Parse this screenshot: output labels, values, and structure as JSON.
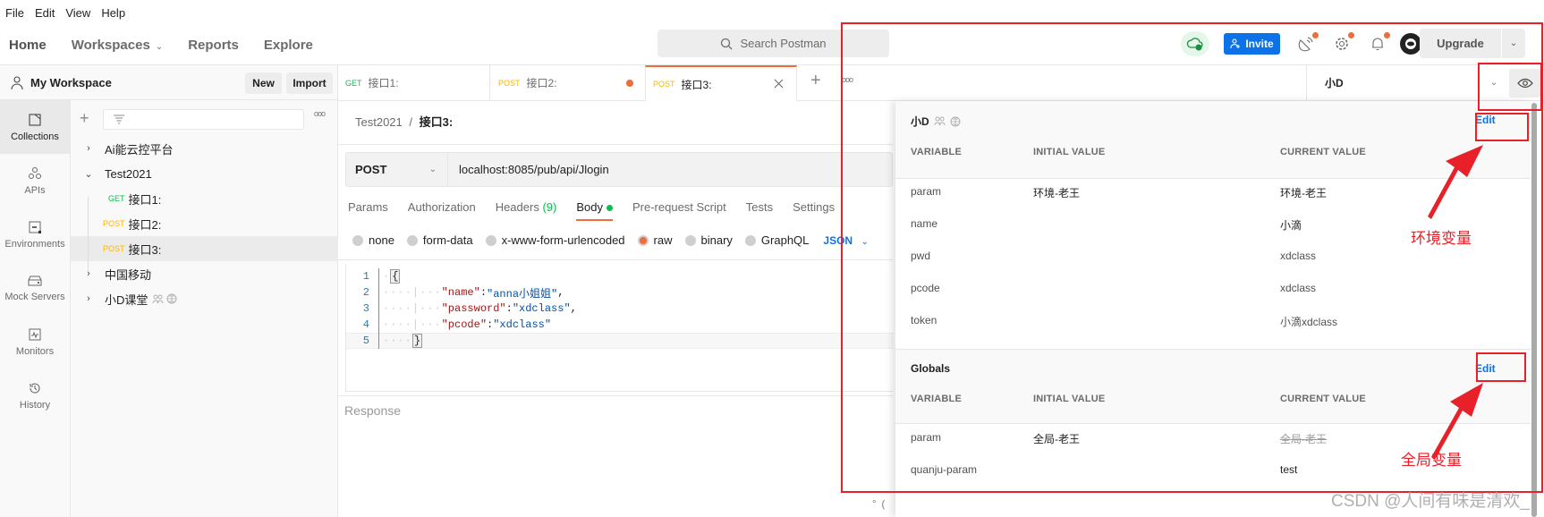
{
  "menu": [
    "File",
    "Edit",
    "View",
    "Help"
  ],
  "header": {
    "nav": [
      "Home",
      "Workspaces",
      "Reports",
      "Explore"
    ],
    "search_placeholder": "Search Postman",
    "invite_label": "Invite",
    "upgrade_label": "Upgrade",
    "icons": [
      "cloud-sync-icon",
      "satellite-icon",
      "settings-icon",
      "bell-icon",
      "avatar"
    ]
  },
  "workspace": {
    "title": "My Workspace",
    "new_label": "New",
    "import_label": "Import"
  },
  "rail": [
    {
      "label": "Collections",
      "icon": "collections-icon",
      "active": true
    },
    {
      "label": "APIs",
      "icon": "apis-icon",
      "active": false
    },
    {
      "label": "Environments",
      "icon": "environments-icon",
      "active": false
    },
    {
      "label": "Mock Servers",
      "icon": "mock-servers-icon",
      "active": false
    },
    {
      "label": "Monitors",
      "icon": "monitors-icon",
      "active": false
    },
    {
      "label": "History",
      "icon": "history-icon",
      "active": false
    }
  ],
  "tree": [
    {
      "label": "Ai能云控平台",
      "type": "collection",
      "expanded": false
    },
    {
      "label": "Test2021",
      "type": "collection",
      "expanded": true
    },
    {
      "label": "接口1:",
      "type": "request",
      "method": "GET"
    },
    {
      "label": "接口2:",
      "type": "request",
      "method": "POST"
    },
    {
      "label": "接口3:",
      "type": "request",
      "method": "POST",
      "selected": true
    },
    {
      "label": "中国移动",
      "type": "collection",
      "expanded": false
    },
    {
      "label": "小D课堂",
      "type": "collection",
      "expanded": false,
      "shared": true
    }
  ],
  "tabs": [
    {
      "method": "GET",
      "label": "接口1:"
    },
    {
      "method": "POST",
      "label": "接口2:",
      "unsaved": true
    },
    {
      "method": "POST",
      "label": "接口3:",
      "active": true
    }
  ],
  "environment": {
    "selected": "小D"
  },
  "request": {
    "breadcrumb_parent": "Test2021",
    "breadcrumb_sep": "/",
    "breadcrumb_current": "接口3:",
    "method": "POST",
    "url": "localhost:8085/pub/api/Jlogin",
    "tabs": [
      "Params",
      "Authorization",
      "Headers",
      "Body",
      "Pre-request Script",
      "Tests",
      "Settings"
    ],
    "headers_count": "(9)",
    "active_tab": "Body",
    "body_types": [
      "none",
      "form-data",
      "x-www-form-urlencoded",
      "raw",
      "binary",
      "GraphQL"
    ],
    "body_type_selected": "raw",
    "format": "JSON",
    "code": {
      "line_numbers": [
        "1",
        "2",
        "3",
        "4",
        "5"
      ],
      "open_brace": "{",
      "close_brace": "}",
      "pairs": [
        {
          "key": "\"name\"",
          "value": "\"anna小姐姐\"",
          "comma": ","
        },
        {
          "key": "\"password\"",
          "value": "\"xdclass\"",
          "comma": ","
        },
        {
          "key": "\"pcode\"",
          "value": "\"xdclass\"",
          "comma": ""
        }
      ]
    },
    "response_label": "Response"
  },
  "quicklook": {
    "env": {
      "name": "小D",
      "edit_label": "Edit",
      "columns": [
        "VARIABLE",
        "INITIAL VALUE",
        "CURRENT VALUE"
      ],
      "rows": [
        {
          "variable": "param",
          "initial": "环境-老王",
          "current": "环境-老王"
        },
        {
          "variable": "name",
          "initial": "",
          "current": "小滴"
        },
        {
          "variable": "pwd",
          "initial": "",
          "current": "xdclass"
        },
        {
          "variable": "pcode",
          "initial": "",
          "current": "xdclass"
        },
        {
          "variable": "token",
          "initial": "",
          "current": "小滴xdclass"
        }
      ]
    },
    "globals": {
      "name": "Globals",
      "edit_label": "Edit",
      "columns": [
        "VARIABLE",
        "INITIAL VALUE",
        "CURRENT VALUE"
      ],
      "rows": [
        {
          "variable": "param",
          "initial": "全局-老王",
          "current": "全局-老王",
          "overridden": true
        },
        {
          "variable": "quanju-param",
          "initial": "",
          "current": "test"
        }
      ]
    }
  },
  "annotations": {
    "env_label": "环境变量",
    "global_label": "全局变量",
    "watermark": "CSDN @人间有味是清欢_"
  }
}
